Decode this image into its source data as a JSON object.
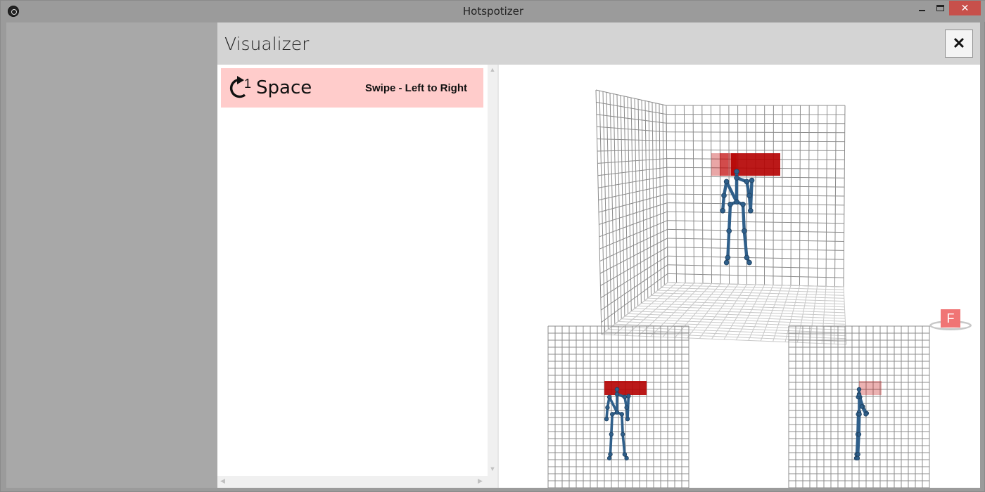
{
  "window": {
    "title": "Hotspotizer",
    "minimize_label": "",
    "maximize_label": "",
    "close_label": "✕"
  },
  "panel": {
    "title": "Visualizer",
    "close_label": "✕"
  },
  "gestures": [
    {
      "count": "1",
      "name": "Space",
      "type": "Swipe - Left to Right",
      "icon": "repeat-arrow-icon"
    }
  ],
  "scrollbar": {
    "up": "▲",
    "down": "▼",
    "left": "◀",
    "right": "▶"
  },
  "view_badge": {
    "label": "F"
  },
  "colors": {
    "highlight_row": "#ffcccb",
    "hotspot": "#c00000",
    "skeleton": "#2f5f8a",
    "close_button": "#c7504b",
    "badge": "#f07575"
  }
}
